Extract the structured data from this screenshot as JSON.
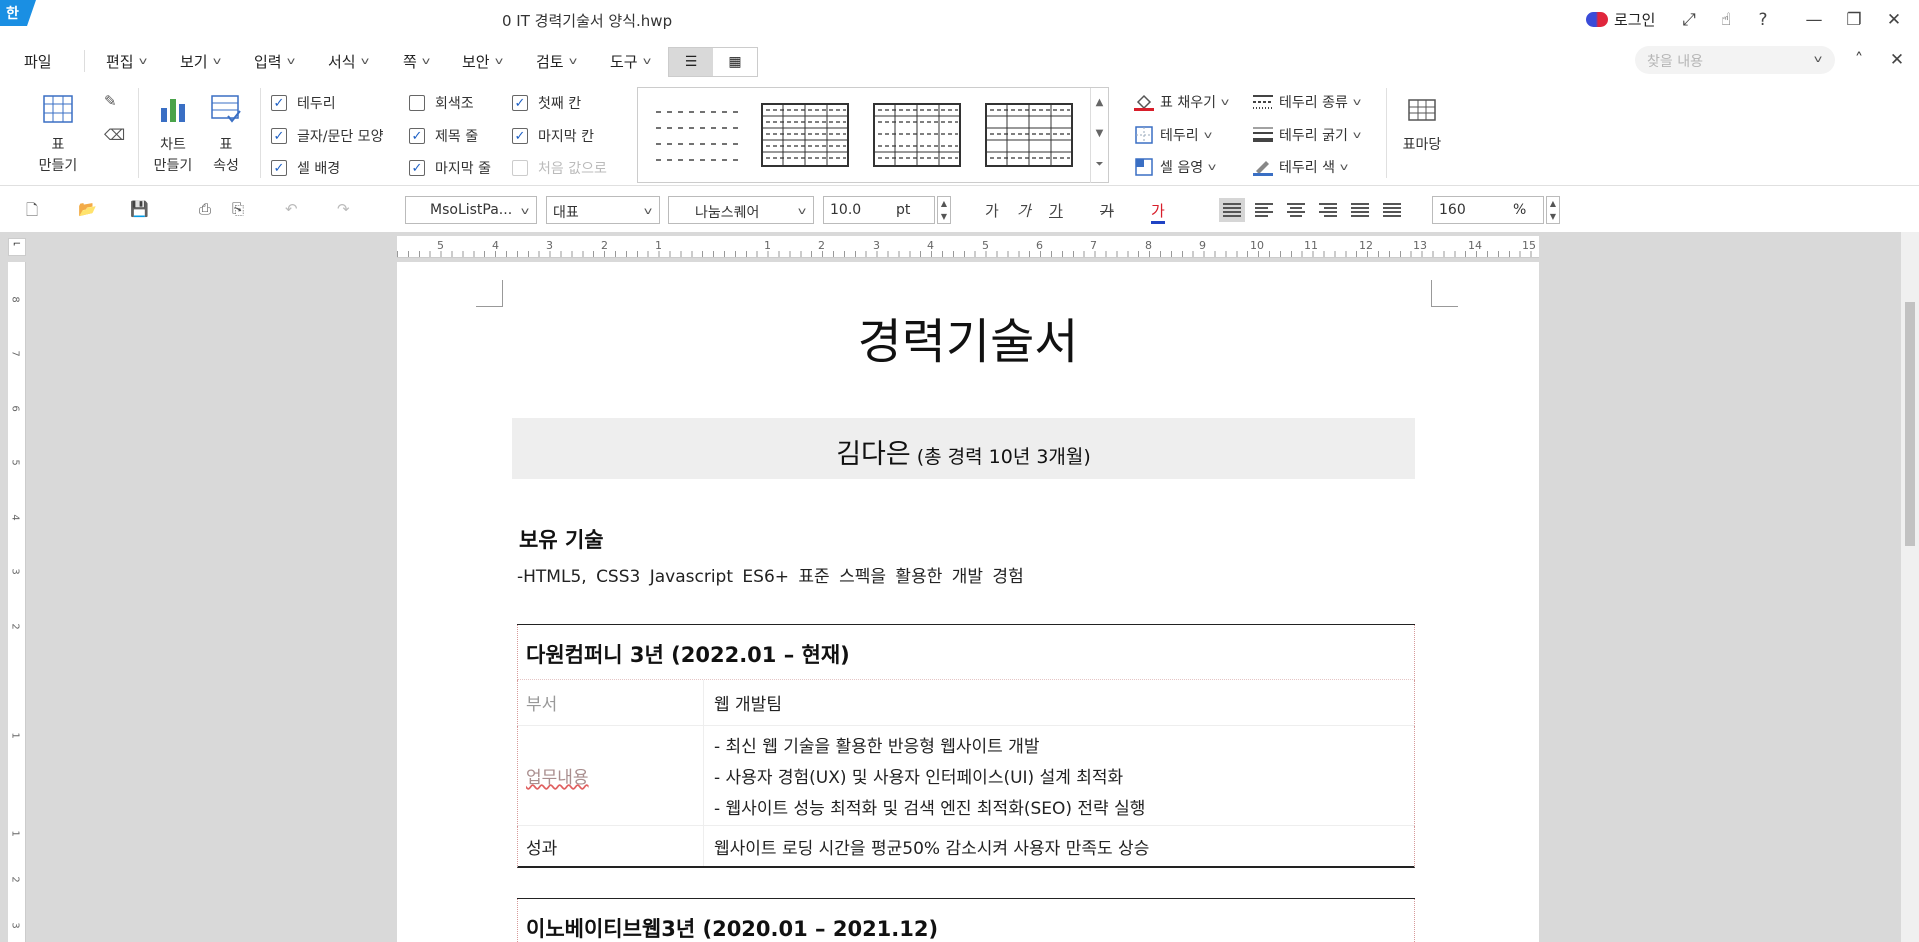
{
  "app": {
    "logo_text": "한",
    "doc_title": "0 IT 경력기술서 양식.hwp",
    "login_label": "로그인"
  },
  "menu": {
    "file": "파일",
    "items": [
      "편집",
      "보기",
      "입력",
      "서식",
      "쪽",
      "보안",
      "검토",
      "도구"
    ],
    "search_placeholder": "찾을 내용"
  },
  "ribbon": {
    "table_make": [
      "표",
      "만들기"
    ],
    "chart_make": [
      "차트",
      "만들기"
    ],
    "table_props": [
      "표",
      "속성"
    ],
    "checks": [
      {
        "label": "테두리",
        "checked": true
      },
      {
        "label": "글자/문단 모양",
        "checked": true
      },
      {
        "label": "셀 배경",
        "checked": true
      },
      {
        "label": "회색조",
        "checked": false
      },
      {
        "label": "제목 줄",
        "checked": true
      },
      {
        "label": "마지막 줄",
        "checked": true
      },
      {
        "label": "첫째 칸",
        "checked": true
      },
      {
        "label": "마지막 칸",
        "checked": true
      },
      {
        "label": "처음 값으로",
        "checked": false,
        "disabled": true
      }
    ],
    "commands": [
      "표 채우기",
      "테두리",
      "셀 음영",
      "테두리 종류",
      "테두리 굵기",
      "테두리 색"
    ],
    "table_wizard": "표마당"
  },
  "toolbar": {
    "style": "MsoListPa...",
    "lang": "대표",
    "font": "나눔스퀘어",
    "size": "10.0",
    "size_unit": "pt",
    "format_glyphs": [
      "가",
      "가",
      "가",
      "가",
      "가"
    ],
    "zoom": "160",
    "zoom_unit": "%"
  },
  "ruler": {
    "h_numbers": [
      "5",
      "4",
      "3",
      "2",
      "1",
      "1",
      "2",
      "3",
      "4",
      "5",
      "6",
      "7",
      "8",
      "9",
      "10",
      "11",
      "12",
      "13",
      "14",
      "15"
    ],
    "v_numbers": [
      "8",
      "7",
      "6",
      "5",
      "4",
      "3",
      "2",
      "1",
      "1",
      "2",
      "3"
    ]
  },
  "document": {
    "heading": "경력기술서",
    "name": "김다은",
    "experience": "(총 경력 10년 3개월)",
    "skills_title": "보유 기술",
    "skills_line": "-HTML5, CSS3 Javascript ES6+ 표준 스펙을 활용한 개발 경험",
    "careers": [
      {
        "title": "다원컴퍼니 3년 (2022.01 – 현재)",
        "dept_label": "부서",
        "dept_value": "웹 개발팀",
        "duty_label": "업무내용",
        "duties": [
          "- 최신 웹 기술을 활용한 반응형 웹사이트 개발",
          "- 사용자 경험(UX) 및 사용자 인터페이스(UI) 설계 최적화",
          "- 웹사이트 성능 최적화 및 검색 엔진 최적화(SEO) 전략 실행"
        ],
        "result_label": "성과",
        "result_value": "웹사이트 로딩 시간을 평균50% 감소시켜 사용자 만족도 상승"
      },
      {
        "title": "이노베이티브웹3년 (2020.01 – 2021.12)"
      }
    ]
  }
}
